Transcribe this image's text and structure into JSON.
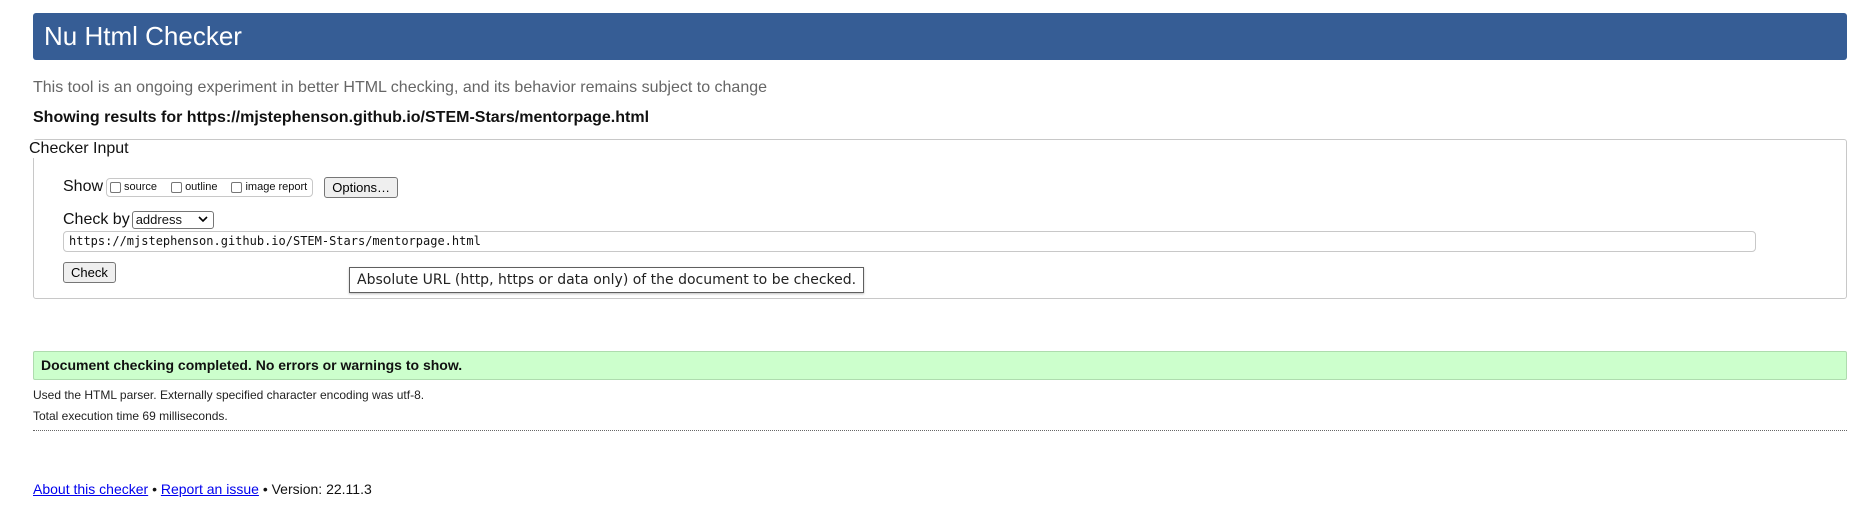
{
  "header": {
    "title": "Nu Html Checker"
  },
  "subtitle": "This tool is an ongoing experiment in better HTML checking, and its behavior remains subject to change",
  "results_for": "Showing results for https://mjstephenson.github.io/STEM-Stars/mentorpage.html",
  "checker_input": {
    "legend": "Checker Input",
    "show_label": "Show",
    "show_options": [
      {
        "label": "source",
        "checked": false
      },
      {
        "label": "outline",
        "checked": false
      },
      {
        "label": "image report",
        "checked": false
      }
    ],
    "options_button": "Options…",
    "check_by_label": "Check by",
    "check_by_selected": "address",
    "url_value": "https://mjstephenson.github.io/STEM-Stars/mentorpage.html",
    "check_button": "Check",
    "tooltip": "Absolute URL (http, https or data only) of the document to be checked."
  },
  "results": {
    "success_message": "Document checking completed. No errors or warnings to show.",
    "parser_info": "Used the HTML parser. Externally specified character encoding was utf-8.",
    "execution_time": "Total execution time 69 milliseconds."
  },
  "footer": {
    "about_link": "About this checker",
    "separator": "•",
    "report_link": "Report an issue",
    "version": "Version: 22.11.3"
  },
  "colors": {
    "header_bg": "#365d95",
    "success_bg": "#ccffcc",
    "link": "#0000ee"
  }
}
